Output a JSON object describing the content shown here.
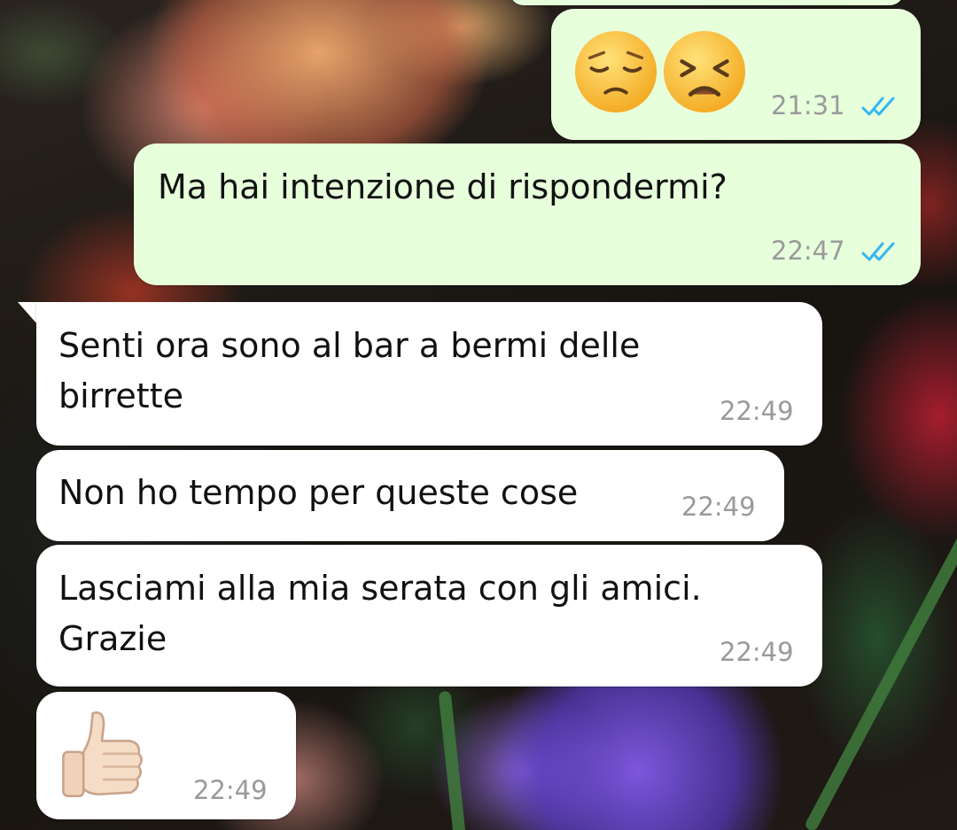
{
  "messages": [
    {
      "direction": "outgoing",
      "emoji": [
        "pensive-face",
        "persevering-face"
      ],
      "time": "21:31",
      "status": "read"
    },
    {
      "direction": "outgoing",
      "text": "Ma hai intenzione di rispondermi?",
      "time": "22:47",
      "status": "read"
    },
    {
      "direction": "incoming",
      "lines": [
        "Senti ora sono al bar a bermi delle",
        "birrette"
      ],
      "time": "22:49"
    },
    {
      "direction": "incoming",
      "text": "Non ho tempo per queste cose",
      "time": "22:49"
    },
    {
      "direction": "incoming",
      "lines": [
        "Lasciami alla mia serata con gli amici.",
        "Grazie"
      ],
      "time": "22:49"
    },
    {
      "direction": "incoming",
      "emoji": [
        "thumbs-up-light-skin"
      ],
      "time": "22:49"
    }
  ],
  "colors": {
    "outgoing_bubble": "#e7ffdb",
    "incoming_bubble": "#ffffff",
    "read_ticks": "#34b7f1",
    "timestamp": "#9a9a9a"
  }
}
